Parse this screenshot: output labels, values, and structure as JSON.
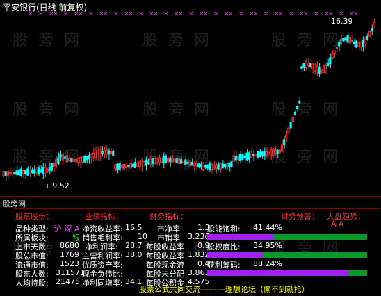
{
  "chart": {
    "title": "平安银行(日线 前复权)",
    "high_label": "16.39",
    "low_label": "9.52",
    "colors": {
      "up": "#ff3232",
      "down": "#00ffff",
      "marker": "#ff40ff"
    }
  },
  "watermark": "股 旁 网",
  "panel": {
    "title": "股旁网",
    "headers": [
      "股东股份：",
      "业绩指标：",
      "财务指标：",
      "财务预警：",
      "大盘趋势："
    ],
    "col1": [
      {
        "label": "品种类型:",
        "value": "沪 深 A"
      },
      {
        "label": "所属板块:",
        "value": "银"
      },
      {
        "label": "上市天数:",
        "value": "8680"
      },
      {
        "label": "股总市值:",
        "value": "1769"
      },
      {
        "label": "流通市值:",
        "value": "1523"
      },
      {
        "label": "股东人数:",
        "value": "311571"
      },
      {
        "label": "人均持股:",
        "value": "21475"
      }
    ],
    "col2": [
      {
        "label": "净资收益率:",
        "value": "16.5"
      },
      {
        "label": "销售毛利率:",
        "value": "10"
      },
      {
        "label": "净利润率:",
        "value": "28.7"
      },
      {
        "label": "主营利润率:",
        "value": "38.0"
      },
      {
        "label": "优质资产率:",
        "value": ""
      },
      {
        "label": "现金负债比:",
        "value": ""
      },
      {
        "label": "净利同增率:",
        "value": "34.1"
      }
    ],
    "col3": [
      {
        "label": "市净率",
        "value": "1.3"
      },
      {
        "label": "市销率",
        "value": "3.236"
      },
      {
        "label": "每股收益率",
        "value": "0.9"
      },
      {
        "label": "每股收益率",
        "value": "1.832"
      },
      {
        "label": "每股现金流",
        "value": "0.4"
      },
      {
        "label": "每股未分配",
        "value": "3.863"
      },
      {
        "label": "每股公积金",
        "value": "4.575"
      }
    ],
    "col4": [
      {
        "label": "股能饱和:",
        "value": "41.44%",
        "fraction": 0.4144
      },
      {
        "label": "股权度比:",
        "value": "34.95%",
        "fraction": 0.3495
      },
      {
        "label": "获利筹码:",
        "value": "88.24%",
        "fraction": 0.8824
      }
    ],
    "trend_mark": "A A",
    "footer": "股票公式共同交流---------理想论坛（偷不到就抢）"
  }
}
